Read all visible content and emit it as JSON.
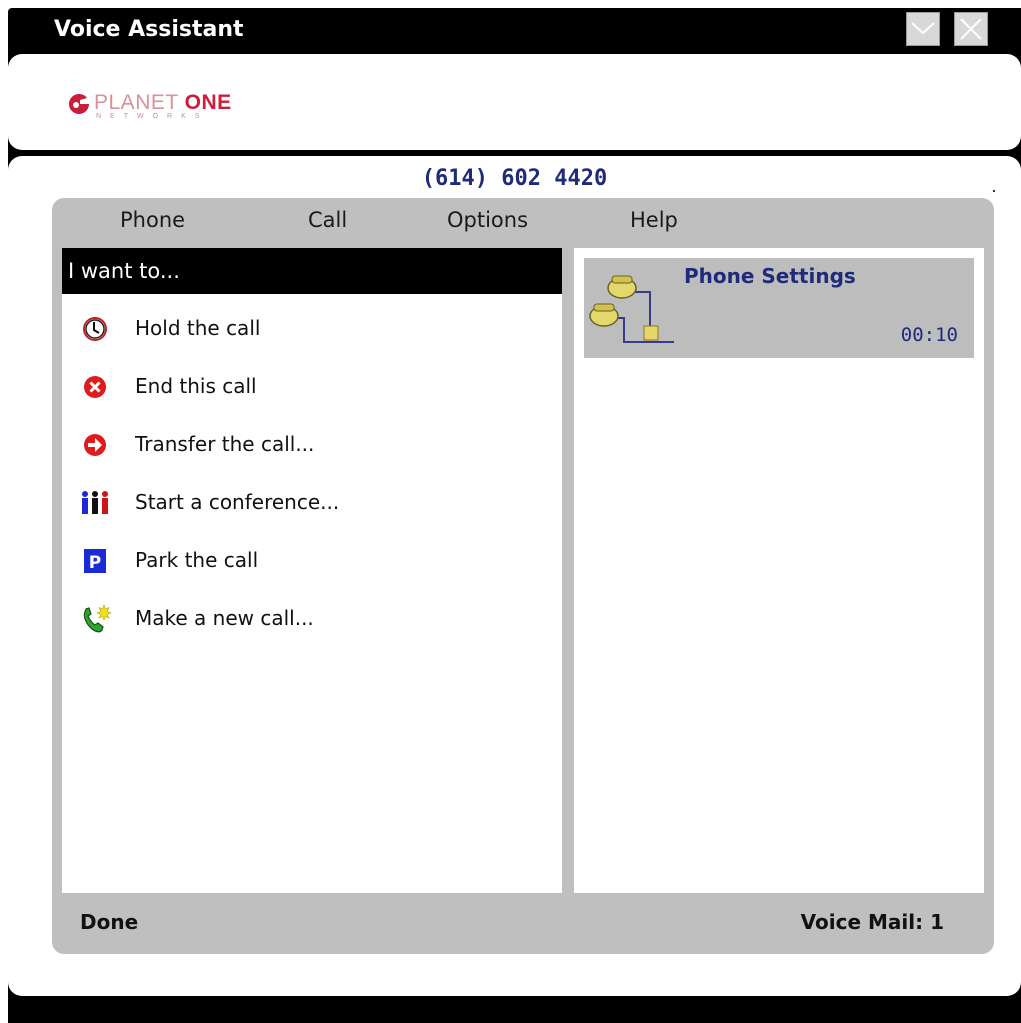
{
  "window": {
    "title": "Voice Assistant",
    "minimize_icon": "chevron-down-icon",
    "close_icon": "close-icon"
  },
  "logo": {
    "text_light": "PLANET",
    "text_bold": "ONE",
    "subtext": "NETWORKS",
    "brand_color": "#cc1e3c"
  },
  "phone_number": "(614) 602 4420",
  "menu": {
    "items": [
      {
        "label": "Phone"
      },
      {
        "label": "Call"
      },
      {
        "label": "Options"
      },
      {
        "label": "Help"
      }
    ]
  },
  "actions": {
    "header": "I want to...",
    "items": [
      {
        "label": "Hold the call",
        "icon": "clock-icon"
      },
      {
        "label": "End this call",
        "icon": "end-call-icon"
      },
      {
        "label": "Transfer the call...",
        "icon": "transfer-arrow-icon"
      },
      {
        "label": "Start a conference...",
        "icon": "conference-people-icon"
      },
      {
        "label": "Park the call",
        "icon": "park-icon"
      },
      {
        "label": "Make a new call...",
        "icon": "new-call-icon"
      }
    ]
  },
  "session": {
    "title": "Phone Settings",
    "time": "00:10",
    "icon": "phones-network-icon"
  },
  "status": {
    "left": "Done",
    "right": "Voice Mail: 1"
  },
  "colors": {
    "accent_text": "#1f2a7a",
    "frame_gray": "#bfbfbf",
    "title_bar": "#000000"
  }
}
